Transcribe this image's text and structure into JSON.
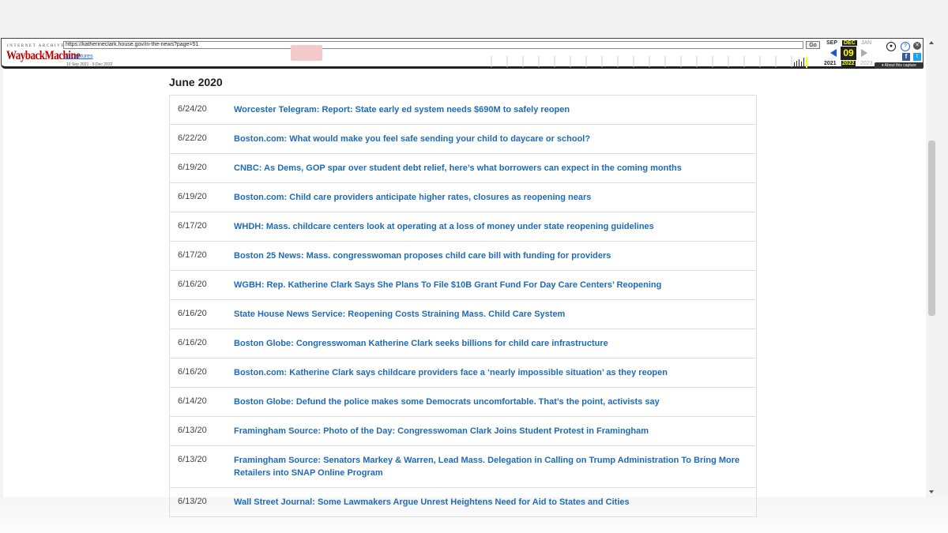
{
  "wayback": {
    "logo_top": "INTERNET ARCHIVE",
    "logo": "WaybackMachine",
    "url": "https://katherineclark.house.gov/in-the-news?page=51",
    "go_label": "Go",
    "captures": "13 captures",
    "range": "10 Sep 2021 - 9 Dec 2022",
    "months": {
      "prev": "SEP",
      "current": "DEC",
      "next": "JAN"
    },
    "day": "09",
    "years": {
      "prev": "2021",
      "current": "2022",
      "next": "2023"
    },
    "about": "About this capture"
  },
  "page": {
    "month_heading": "June 2020",
    "news": [
      {
        "date": "6/24/20",
        "title": "Worcester Telegram: Report: State early ed system needs $690M to safely reopen"
      },
      {
        "date": "6/22/20",
        "title": "Boston.com: What would make you feel safe sending your child to daycare or school?"
      },
      {
        "date": "6/19/20",
        "title": "CNBC: As Dems, GOP spar over student debt relief, here’s what borrowers can expect in the coming months"
      },
      {
        "date": "6/19/20",
        "title": "Boston.com: Child care providers anticipate higher rates, closures as reopening nears"
      },
      {
        "date": "6/17/20",
        "title": "WHDH: Mass. childcare centers look at operating at a loss of money under state reopening guidelines"
      },
      {
        "date": "6/17/20",
        "title": "Boston 25 News: Mass. congresswoman proposes child care bill with funding for providers"
      },
      {
        "date": "6/16/20",
        "title": "WGBH: Rep. Katherine Clark Says She Plans To File $10B Grant Fund For Day Care Centers’ Reopening"
      },
      {
        "date": "6/16/20",
        "title": "State House News Service: Reopening Costs Straining Mass. Child Care System"
      },
      {
        "date": "6/16/20",
        "title": "Boston Globe: Congresswoman Katherine Clark seeks billions for child care infrastructure"
      },
      {
        "date": "6/16/20",
        "title": "Boston.com: Katherine Clark says childcare providers face a ‘nearly impossible situation’ as they reopen"
      },
      {
        "date": "6/14/20",
        "title": "Boston Globe: Defund the police makes some Democrats uncomfortable. That’s the point, activists say"
      },
      {
        "date": "6/13/20",
        "title": "Framingham Source: Photo of the Day: Congresswoman Clark Joins Student Protest in Framingham"
      },
      {
        "date": "6/13/20",
        "title": "Framingham Source: Senators Markey & Warren, Lead Mass. Delegation in Calling on Trump Administration To Bring More Retailers into SNAP Online Program"
      },
      {
        "date": "6/13/20",
        "title": "Wall Street Journal: Some Lawmakers Argue Unrest Heightens Need for Aid to States and Cities"
      }
    ]
  }
}
